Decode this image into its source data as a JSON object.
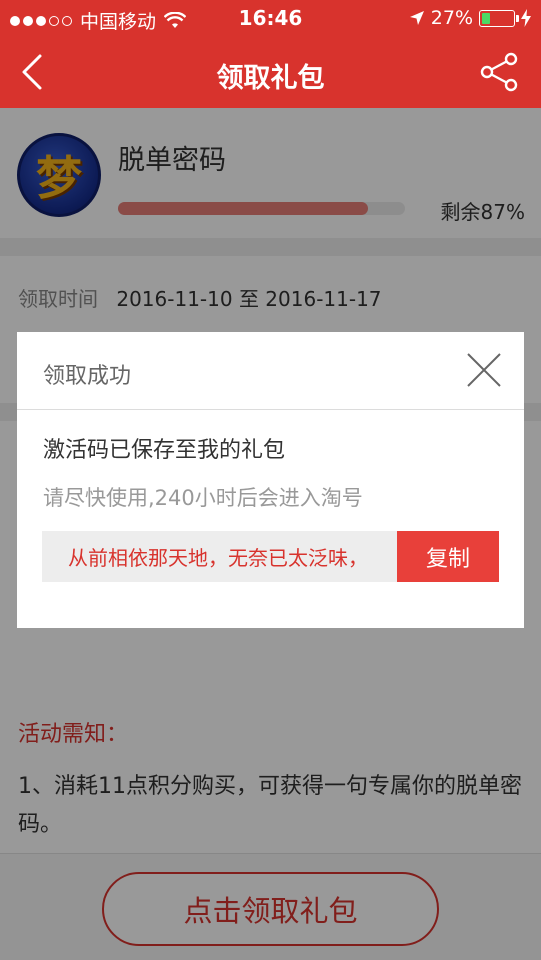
{
  "status_bar": {
    "carrier": "中国移动",
    "time": "16:46",
    "battery": "27%",
    "battery_level": 0.27
  },
  "navbar": {
    "title": "领取礼包",
    "back_icon": "chevron-left-icon",
    "share_icon": "share-icon"
  },
  "gift": {
    "avatar_text": "梦",
    "name": "脱单密码",
    "remaining_label": "剩余87%",
    "remaining_fraction": 0.87
  },
  "claim_time": {
    "label": "领取时间",
    "value": "2016-11-10 至 2016-11-17"
  },
  "notice": {
    "title": "活动需知：",
    "text": "1、消耗11点积分购买，可获得一句专属你的脱单密码。"
  },
  "claim_button": "点击领取礼包",
  "modal": {
    "title": "领取成功",
    "message": "激活码已保存至我的礼包",
    "hint": "请尽快使用,240小时后会进入淘号",
    "code": "从前相依那天地，无奈已太泛味，",
    "copy_label": "复制"
  },
  "colors": {
    "brand_red": "#d8332d",
    "copy_red": "#e8403a",
    "progress": "#e67d77"
  }
}
